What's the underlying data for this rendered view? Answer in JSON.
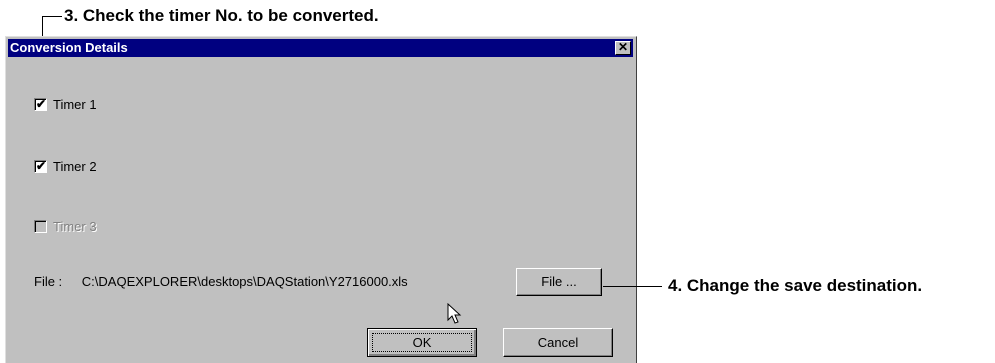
{
  "callouts": {
    "step3": "3. Check the timer No. to be converted.",
    "step4": "4. Change the save destination."
  },
  "dialog": {
    "title": "Conversion Details",
    "close_glyph": "✕",
    "timers": [
      {
        "label": "Timer 1",
        "checked": true,
        "enabled": true
      },
      {
        "label": "Timer 2",
        "checked": true,
        "enabled": true
      },
      {
        "label": "Timer 3",
        "checked": false,
        "enabled": false
      }
    ],
    "file_label": "File :",
    "file_path": "C:\\DAQEXPLORER\\desktops\\DAQStation\\Y2716000.xls",
    "file_button": "File ...",
    "ok_button": "OK",
    "cancel_button": "Cancel"
  },
  "icons": {
    "checkmark": "✔",
    "cursor": "mouse-pointer-icon"
  }
}
